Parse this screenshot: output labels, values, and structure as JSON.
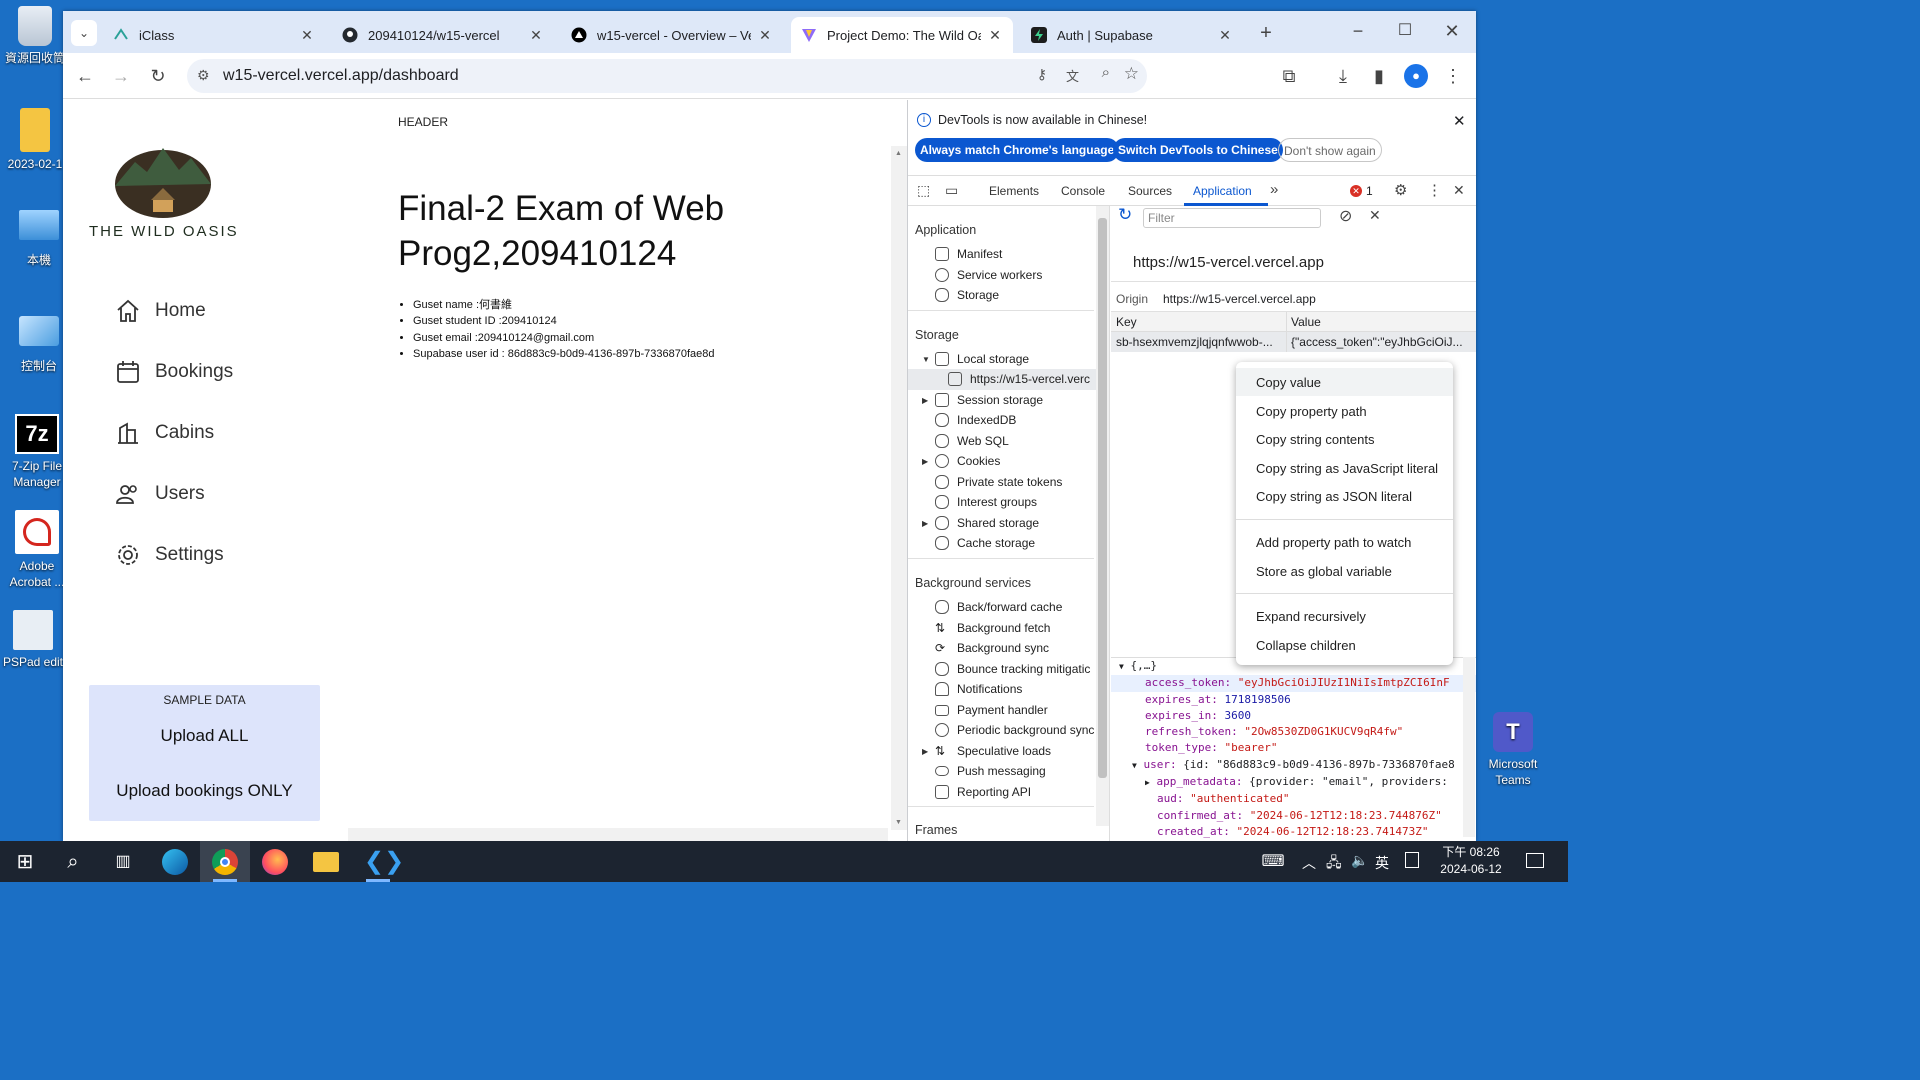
{
  "desktop": {
    "icons": [
      {
        "label": "資源回收筒"
      },
      {
        "label": "2023-02-1"
      },
      {
        "label": "本機"
      },
      {
        "label": "控制台"
      },
      {
        "label": "7-Zip File Manager"
      },
      {
        "label": "Adobe Acrobat ..."
      },
      {
        "label": "PSPad edit"
      },
      {
        "label": "Microsoft Teams"
      }
    ]
  },
  "browser": {
    "tabs": [
      {
        "title": "iClass"
      },
      {
        "title": "209410124/w15-vercel"
      },
      {
        "title": "w15-vercel - Overview – Ve"
      },
      {
        "title": "Project Demo: The Wild Oa"
      },
      {
        "title": "Auth | Supabase"
      }
    ],
    "url": "w15-vercel.vercel.app/dashboard"
  },
  "app": {
    "logo_text": "THE WILD OASIS",
    "nav": [
      {
        "label": "Home",
        "icon": "home-icon"
      },
      {
        "label": "Bookings",
        "icon": "calendar-icon"
      },
      {
        "label": "Cabins",
        "icon": "building-icon"
      },
      {
        "label": "Users",
        "icon": "users-icon"
      },
      {
        "label": "Settings",
        "icon": "gear-icon"
      }
    ],
    "header": "HEADER",
    "title": "Final-2 Exam of Web Prog2,209410124",
    "info": [
      "Guset name :何書維",
      "Guset student ID :209410124",
      "Guset email :209410124@gmail.com",
      "Supabase user id : 86d883c9-b0d9-4136-897b-7336870fae8d"
    ],
    "sample": {
      "title": "SAMPLE DATA",
      "upload_all": "Upload ALL",
      "upload_bookings": "Upload bookings ONLY"
    }
  },
  "devtools": {
    "infobar": {
      "message": "DevTools is now available in Chinese!",
      "btn_match": "Always match Chrome's language",
      "btn_switch": "Switch DevTools to Chinese",
      "btn_dont": "Don't show again"
    },
    "tabs": [
      "Elements",
      "Console",
      "Sources",
      "Application"
    ],
    "error_count": "1",
    "sidebar": {
      "application_heading": "Application",
      "application_items": [
        "Manifest",
        "Service workers",
        "Storage"
      ],
      "storage_heading": "Storage",
      "storage_items": [
        "Local storage",
        "https://w15-vercel.verc",
        "Session storage",
        "IndexedDB",
        "Web SQL",
        "Cookies",
        "Private state tokens",
        "Interest groups",
        "Shared storage",
        "Cache storage"
      ],
      "bg_heading": "Background services",
      "bg_items": [
        "Back/forward cache",
        "Background fetch",
        "Background sync",
        "Bounce tracking mitigatic",
        "Notifications",
        "Payment handler",
        "Periodic background sync",
        "Speculative loads",
        "Push messaging",
        "Reporting API"
      ],
      "frames_heading": "Frames"
    },
    "main": {
      "filter_placeholder": "Filter",
      "origin_url": "https://w15-vercel.vercel.app",
      "origin_label": "Origin",
      "origin_value": "https://w15-vercel.vercel.app",
      "col_key": "Key",
      "col_value": "Value",
      "row_key": "sb-hsexmvemzjlqjqnfwwob-...",
      "row_value": "{\"access_token\":\"eyJhbGciOiJ..."
    },
    "code": {
      "root": "{,…}",
      "access_token_key": "access_token:",
      "access_token_val": "\"eyJhbGciOiJIUzI1NiIsImtpZCI6InF",
      "expires_at_key": "expires_at:",
      "expires_at_val": "1718198506",
      "expires_in_key": "expires_in:",
      "expires_in_val": "3600",
      "refresh_token_key": "refresh_token:",
      "refresh_token_val": "\"2Ow8530ZD0G1KUCV9qR4fw\"",
      "token_type_key": "token_type:",
      "token_type_val": "\"bearer\"",
      "user_key": "user:",
      "user_val": "{id: \"86d883c9-b0d9-4136-897b-7336870fae8",
      "app_meta_key": "app_metadata:",
      "app_meta_val": "{provider: \"email\", providers:",
      "aud_key": "aud:",
      "aud_val": "\"authenticated\"",
      "confirmed_key": "confirmed_at:",
      "confirmed_val": "\"2024-06-12T12:18:23.744876Z\"",
      "created_key": "created_at:",
      "created_val": "\"2024-06-12T12:18:23.741473Z\""
    },
    "context_menu": [
      "Copy value",
      "Copy property path",
      "Copy string contents",
      "Copy string as JavaScript literal",
      "Copy string as JSON literal",
      "Add property path to watch",
      "Store as global variable",
      "Expand recursively",
      "Collapse children"
    ]
  },
  "taskbar": {
    "time": "下午 08:26",
    "date": "2024-06-12",
    "ime": "英"
  }
}
